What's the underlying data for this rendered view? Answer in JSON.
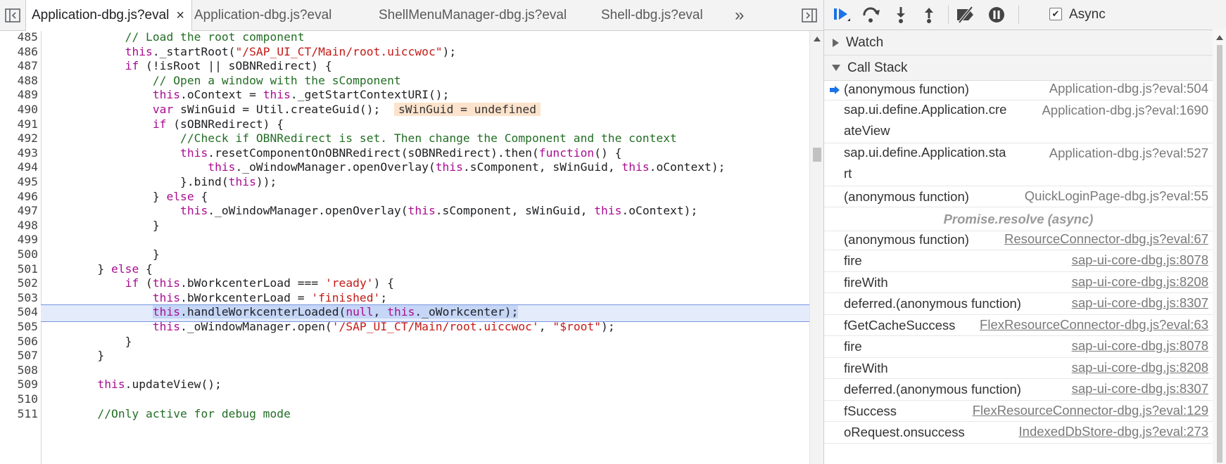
{
  "editor": {
    "tabs": [
      {
        "label": "Application-dbg.js?eval",
        "active": true
      },
      {
        "label": "Application-dbg.js?eval",
        "active": false
      },
      {
        "label": "ShellMenuManager-dbg.js?eval",
        "active": false
      },
      {
        "label": "Shell-dbg.js?eval",
        "active": false
      }
    ],
    "tab_close": "×",
    "tab_overflow": "»",
    "current_line": 504,
    "lines": [
      {
        "n": "485",
        "code": "            // Load the root component"
      },
      {
        "n": "486",
        "code": "            this._startRoot(\"/SAP_UI_CT/Main/root.uiccwoc\");"
      },
      {
        "n": "487",
        "code": "            if (!isRoot || sOBNRedirect) {"
      },
      {
        "n": "488",
        "code": "                // Open a window with the sComponent"
      },
      {
        "n": "489",
        "code": "                this.oContext = this._getStartContextURI();"
      },
      {
        "n": "490",
        "code": "                var sWinGuid = Util.createGuid();"
      },
      {
        "n": "491",
        "code": "                if (sOBNRedirect) {"
      },
      {
        "n": "492",
        "code": "                    //Check if OBNRedirect is set. Then change the Component and the context"
      },
      {
        "n": "493",
        "code": "                    this.resetComponentOnOBNRedirect(sOBNRedirect).then(function() {"
      },
      {
        "n": "494",
        "code": "                        this._oWindowManager.openOverlay(this.sComponent, sWinGuid, this.oContext);"
      },
      {
        "n": "495",
        "code": "                    }.bind(this));"
      },
      {
        "n": "496",
        "code": "                } else {"
      },
      {
        "n": "497",
        "code": "                    this._oWindowManager.openOverlay(this.sComponent, sWinGuid, this.oContext);"
      },
      {
        "n": "498",
        "code": "                }"
      },
      {
        "n": "499",
        "code": ""
      },
      {
        "n": "500",
        "code": "                }"
      },
      {
        "n": "501",
        "code": "        } else {"
      },
      {
        "n": "502",
        "code": "            if (this.bWorkcenterLoad === 'ready') {"
      },
      {
        "n": "503",
        "code": "                this.bWorkcenterLoad = 'finished';"
      },
      {
        "n": "504",
        "code": "                this.handleWorkcenterLoaded(null, this._oWorkcenter);"
      },
      {
        "n": "505",
        "code": "                this._oWindowManager.open('/SAP_UI_CT/Main/root.uiccwoc', \"$root\");"
      },
      {
        "n": "506",
        "code": "            }"
      },
      {
        "n": "507",
        "code": "        }"
      },
      {
        "n": "508",
        "code": ""
      },
      {
        "n": "509",
        "code": "        this.updateView();"
      },
      {
        "n": "510",
        "code": ""
      },
      {
        "n": "511",
        "code": "        //Only active for debug mode"
      }
    ],
    "inline_value": "sWinGuid = undefined"
  },
  "sidebar": {
    "async_label": "Async",
    "async_checked": true,
    "watch_label": "Watch",
    "callstack_label": "Call Stack",
    "frames": [
      {
        "fn": "(anonymous function)",
        "loc": "Application-dbg.js?eval:504",
        "current": true,
        "link": false
      },
      {
        "fn": "sap.ui.define.Application.createView",
        "loc": "Application-dbg.js?eval:1690",
        "current": false,
        "link": false
      },
      {
        "fn": "sap.ui.define.Application.start",
        "loc": "Application-dbg.js?eval:527",
        "current": false,
        "link": false
      },
      {
        "fn": "(anonymous function)",
        "loc": "QuickLoginPage-dbg.js?eval:55",
        "current": false,
        "link": false
      },
      {
        "separator": "Promise.resolve (async)"
      },
      {
        "fn": "(anonymous function)",
        "loc": "ResourceConnector-dbg.js?eval:67",
        "current": false,
        "link": true
      },
      {
        "fn": "fire",
        "loc": "sap-ui-core-dbg.js:8078",
        "current": false,
        "link": true
      },
      {
        "fn": "fireWith",
        "loc": "sap-ui-core-dbg.js:8208",
        "current": false,
        "link": true
      },
      {
        "fn": "deferred.(anonymous function)",
        "loc": "sap-ui-core-dbg.js:8307",
        "current": false,
        "link": true
      },
      {
        "fn": "fGetCacheSuccess",
        "loc": "FlexResourceConnector-dbg.js?eval:63",
        "current": false,
        "link": true
      },
      {
        "fn": "fire",
        "loc": "sap-ui-core-dbg.js:8078",
        "current": false,
        "link": true
      },
      {
        "fn": "fireWith",
        "loc": "sap-ui-core-dbg.js:8208",
        "current": false,
        "link": true
      },
      {
        "fn": "deferred.(anonymous function)",
        "loc": "sap-ui-core-dbg.js:8307",
        "current": false,
        "link": true
      },
      {
        "fn": "fSuccess",
        "loc": "FlexResourceConnector-dbg.js?eval:129",
        "current": false,
        "link": true
      },
      {
        "fn": "oRequest.onsuccess",
        "loc": "IndexedDbStore-dbg.js?eval:273",
        "current": false,
        "link": true
      }
    ]
  },
  "colors": {
    "keyword": "#aa0d91",
    "string": "#c41a16",
    "comment": "#236e25",
    "accent": "#1a73e8",
    "exec_line_bg": "#e4ecfb",
    "inline_value_bg": "#fde3cc"
  }
}
